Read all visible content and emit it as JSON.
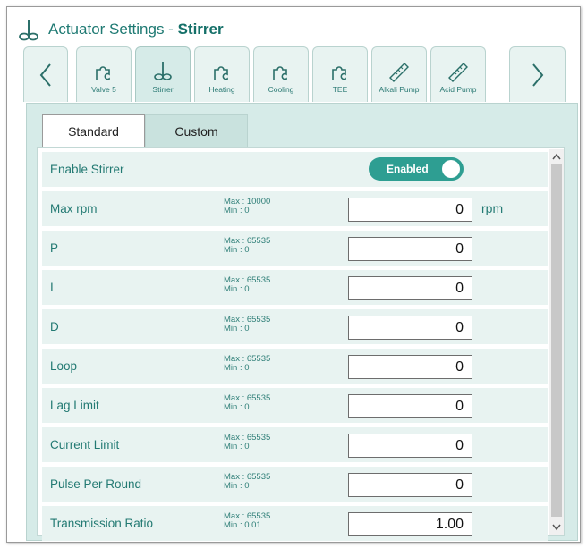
{
  "header": {
    "title_prefix": "Actuator Settings - ",
    "title_device": "Stirrer"
  },
  "actuator_tabs": [
    {
      "label": "Valve 5",
      "icon": "puzzle-icon",
      "active": false
    },
    {
      "label": "Stirrer",
      "icon": "stirrer-icon",
      "active": true
    },
    {
      "label": "Heating",
      "icon": "puzzle-icon",
      "active": false
    },
    {
      "label": "Cooling",
      "icon": "puzzle-icon",
      "active": false
    },
    {
      "label": "TEE",
      "icon": "puzzle-icon",
      "active": false
    },
    {
      "label": "Alkali Pump",
      "icon": "pump-tube-icon",
      "active": false
    },
    {
      "label": "Acid Pump",
      "icon": "pump-tube-icon",
      "active": false
    }
  ],
  "subtabs": [
    {
      "label": "Standard",
      "active": false
    },
    {
      "label": "Custom",
      "active": true
    }
  ],
  "enable": {
    "label": "Enable Stirrer",
    "toggle_label": "Enabled",
    "on": true
  },
  "params": [
    {
      "label": "Max rpm",
      "max": "Max : 10000",
      "min": "Min : 0",
      "value": "0",
      "unit": "rpm"
    },
    {
      "label": "P",
      "max": "Max : 65535",
      "min": "Min : 0",
      "value": "0"
    },
    {
      "label": "I",
      "max": "Max : 65535",
      "min": "Min : 0",
      "value": "0"
    },
    {
      "label": "D",
      "max": "Max : 65535",
      "min": "Min : 0",
      "value": "0"
    },
    {
      "label": "Loop",
      "max": "Max : 65535",
      "min": "Min : 0",
      "value": "0"
    },
    {
      "label": "Lag Limit",
      "max": "Max : 65535",
      "min": "Min : 0",
      "value": "0"
    },
    {
      "label": "Current Limit",
      "max": "Max : 65535",
      "min": "Min : 0",
      "value": "0"
    },
    {
      "label": "Pulse Per Round",
      "max": "Max : 65535",
      "min": "Min : 0",
      "value": "0"
    },
    {
      "label": "Transmission Ratio",
      "max": "Max : 65535",
      "min": "Min : 0.01",
      "value": "1.00"
    }
  ],
  "colors": {
    "accent": "#2e9e92",
    "tab_bg": "#e8f3f1",
    "panel_bg": "#d6ebe8",
    "text": "#237a73"
  }
}
